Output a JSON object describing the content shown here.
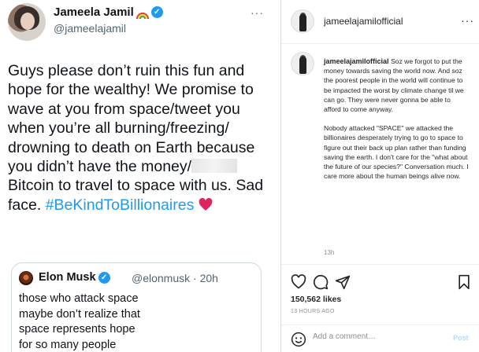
{
  "twitter": {
    "display_name": "Jameela Jamil",
    "handle": "@jameelajamil",
    "more": "···",
    "tweet": {
      "line1": "Guys please don’t ruin this fun and",
      "line2": "hope for the wealthy! We promise to",
      "line3": "wave at you from space/tweet you",
      "line4": "when you’re all burning/freezing/",
      "line5": "drowning to death on Earth because",
      "line6": "you didn’t have the money/",
      "line7": "Bitcoin to travel to space with us. Sad",
      "line8_pre": "face. ",
      "hashtag": "#BeKindToBillionaires"
    },
    "quote": {
      "name": "Elon Musk",
      "handle": "@elonmusk · 20h",
      "line1": "those who attack space",
      "line2": "maybe don’t realize that",
      "line3": "space represents hope",
      "line4": "for so many people"
    },
    "colors": {
      "link": "#1d9bf0",
      "verified": "#1d9bf0",
      "heart": "#e0245e"
    }
  },
  "instagram": {
    "username": "jameelajamilofficial",
    "more": "···",
    "caption_user": "jameelajamilofficial",
    "caption_p1": "Soz we forgot to put the money towards saving the world now. And soz the poorest people in the world will continue to be impacted the worst by climate change til we can go. They were never gonna be able to afford to come anyway.",
    "caption_p2": "Nobody attacked \"SPACE\" we attacked the billionaires desperately trying to go to space to figure out their back up plan rather than funding saving the earth. I don't care for the \"what about the future of our species?\" Conversation much. I care more about the human beings alive now.",
    "caption_time": "13h",
    "likes": "150,562 likes",
    "ago": "13 HOURS AGO",
    "comment_placeholder": "Add a comment…",
    "post_label": "Post"
  }
}
